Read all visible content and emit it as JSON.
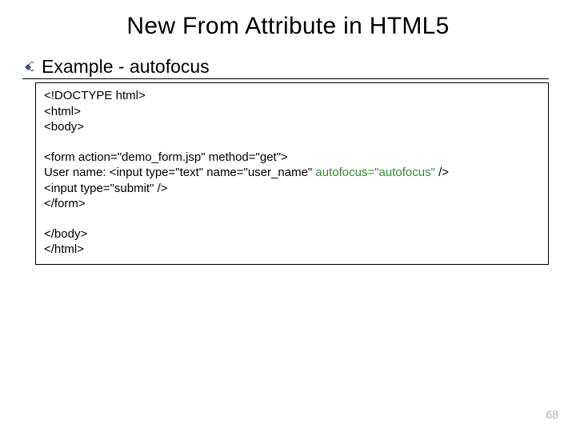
{
  "title": "New From Attribute in HTML5",
  "subtitle": "Example - autofocus",
  "code": {
    "l1": "<!DOCTYPE html>",
    "l2": "<html>",
    "l3": "<body>",
    "l4": "<form action=\"demo_form.jsp\" method=\"get\">",
    "l5a": "User name: <input type=\"text\" name=\"user_name\" ",
    "l5b": "autofocus=\"autofocus\"",
    "l5c": " />",
    "l6": "<input type=\"submit\" />",
    "l7": "</form>",
    "l8": "</body>",
    "l9": "</html>"
  },
  "page_number": "68"
}
